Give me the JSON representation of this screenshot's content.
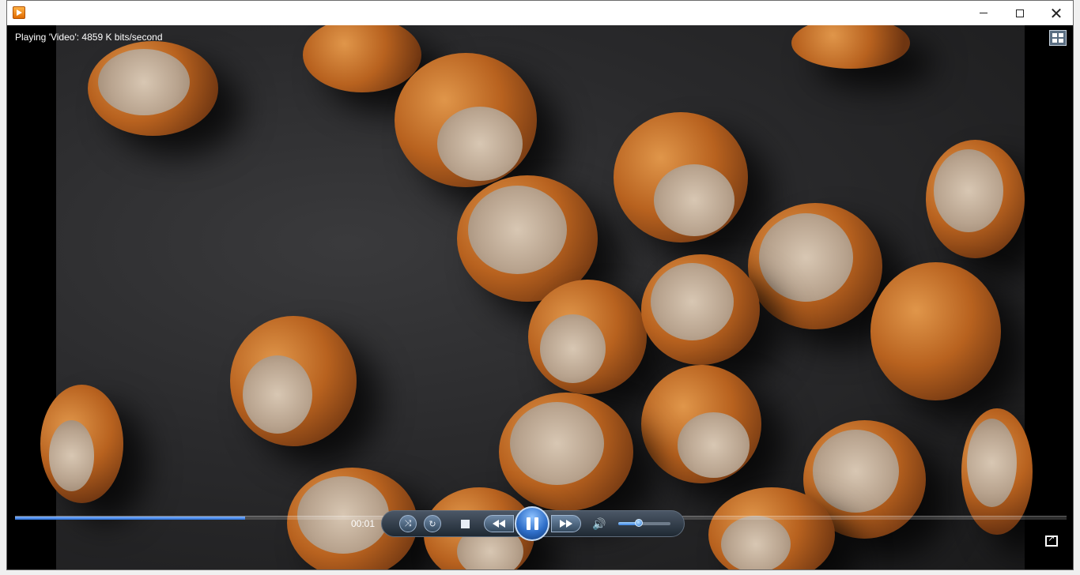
{
  "window": {
    "minimize_label": "—",
    "maximize_label": "",
    "close_label": "✕"
  },
  "player": {
    "status": "Playing 'Video': 4859 K bits/second",
    "elapsed": "00:01",
    "progress_fraction": 0.219,
    "volume_fraction": 0.39,
    "state": "playing"
  },
  "icons": {
    "app": "windows-media-player-icon",
    "layout": "switch-to-library-icon",
    "shuffle": "shuffle-icon",
    "repeat": "repeat-icon",
    "stop": "stop-icon",
    "previous": "previous-icon",
    "pause": "pause-icon",
    "next": "next-icon",
    "mute": "speaker-icon",
    "fullscreen": "fullscreen-icon"
  },
  "colors": {
    "accent": "#2a6fd6",
    "control_bg": "#1f2933"
  }
}
